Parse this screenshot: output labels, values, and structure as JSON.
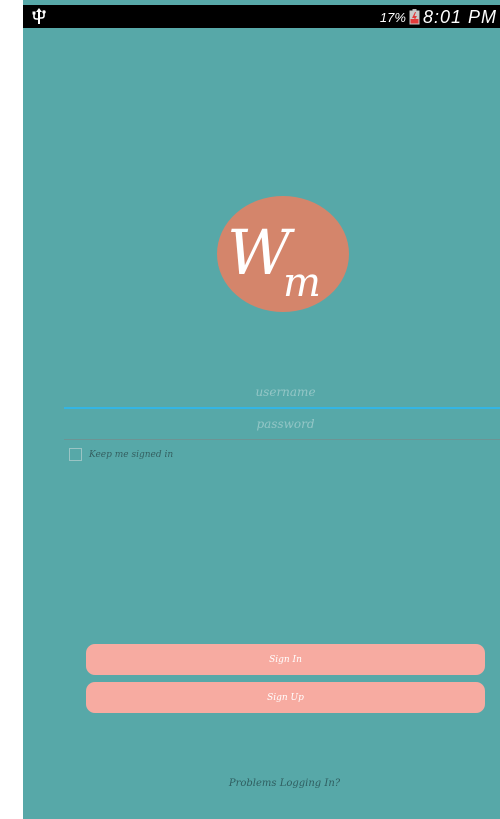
{
  "status_bar": {
    "usb_icon": "usb-icon",
    "battery_percent": "17%",
    "battery_icon": "battery-low-icon",
    "time": "8:01 PM"
  },
  "logo": {
    "text": "Wm",
    "background_color": "#d4856b"
  },
  "login_form": {
    "username_placeholder": "username",
    "username_value": "",
    "password_placeholder": "password",
    "password_value": "",
    "keep_signed_in_label": "Keep me signed in",
    "keep_signed_in_checked": false
  },
  "buttons": {
    "sign_in_label": "Sign In",
    "sign_up_label": "Sign Up"
  },
  "footer": {
    "problems_link": "Problems Logging In?"
  },
  "colors": {
    "background": "#57a8a8",
    "button": "#f7aba1",
    "accent_underline": "#33b5e5"
  }
}
